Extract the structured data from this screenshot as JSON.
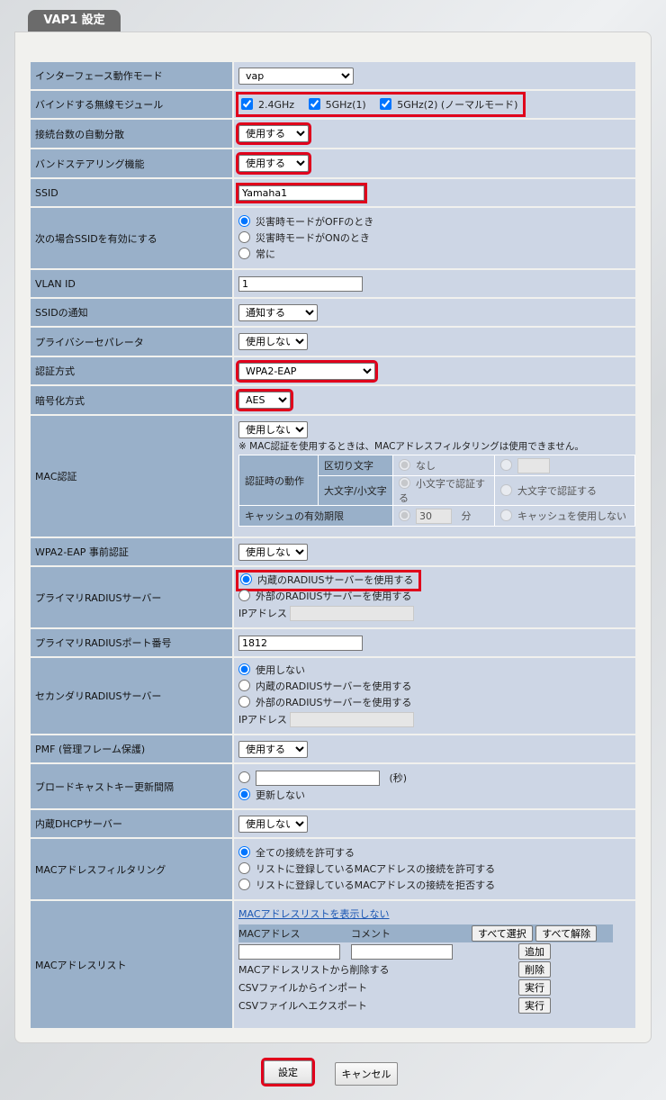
{
  "title": "VAP1 設定",
  "rows": {
    "interface_mode": {
      "label": "インターフェース動作モード",
      "value": "vap"
    },
    "bind_module": {
      "label": "バインドする無線モジュール",
      "opt1": "2.4GHz",
      "opt2": "5GHz(1)",
      "opt3": "5GHz(2) (ノーマルモード)"
    },
    "auto_distribute": {
      "label": "接続台数の自動分散",
      "value": "使用する"
    },
    "band_steering": {
      "label": "バンドステアリング機能",
      "value": "使用する"
    },
    "ssid": {
      "label": "SSID",
      "value": "Yamaha1"
    },
    "ssid_enable": {
      "label": "次の場合SSIDを有効にする",
      "opt1": "災害時モードがOFFのとき",
      "opt2": "災害時モードがONのとき",
      "opt3": "常に"
    },
    "vlan": {
      "label": "VLAN ID",
      "value": "1"
    },
    "ssid_notify": {
      "label": "SSIDの通知",
      "value": "通知する"
    },
    "privacy": {
      "label": "プライバシーセパレータ",
      "value": "使用しない"
    },
    "auth": {
      "label": "認証方式",
      "value": "WPA2-EAP"
    },
    "enc": {
      "label": "暗号化方式",
      "value": "AES"
    },
    "mac_auth": {
      "label": "MAC認証",
      "value": "使用しない",
      "note": "※ MAC認証を使用するときは、MACアドレスフィルタリングは使用できません。",
      "action": "認証時の動作",
      "sep": "区切り文字",
      "none": "なし",
      "case": "大文字/小文字",
      "lower": "小文字で認証する",
      "upper": "大文字で認証する",
      "cache": "キャッシュの有効期限",
      "cache_val": "30",
      "min": "分",
      "nocache": "キャッシュを使用しない"
    },
    "preauth": {
      "label": "WPA2-EAP 事前認証",
      "value": "使用しない"
    },
    "primary_radius": {
      "label": "プライマリRADIUSサーバー",
      "opt1": "内蔵のRADIUSサーバーを使用する",
      "opt2": "外部のRADIUSサーバーを使用する",
      "ip": "IPアドレス"
    },
    "primary_port": {
      "label": "プライマリRADIUSポート番号",
      "value": "1812"
    },
    "secondary_radius": {
      "label": "セカンダリRADIUSサーバー",
      "opt1": "使用しない",
      "opt2": "内蔵のRADIUSサーバーを使用する",
      "opt3": "外部のRADIUSサーバーを使用する",
      "ip": "IPアドレス"
    },
    "pmf": {
      "label": "PMF (管理フレーム保護)",
      "value": "使用する"
    },
    "broadcast": {
      "label": "ブロードキャストキー更新間隔",
      "unit": "(秒)",
      "opt2": "更新しない"
    },
    "dhcp": {
      "label": "内蔵DHCPサーバー",
      "value": "使用しない"
    },
    "mac_filter": {
      "label": "MACアドレスフィルタリング",
      "opt1": "全ての接続を許可する",
      "opt2": "リストに登録しているMACアドレスの接続を許可する",
      "opt3": "リストに登録しているMACアドレスの接続を拒否する"
    },
    "mac_list": {
      "label": "MACアドレスリスト",
      "link": "MACアドレスリストを表示しない",
      "col1": "MACアドレス",
      "col2": "コメント",
      "select_all": "すべて選択",
      "deselect_all": "すべて解除",
      "add": "追加",
      "delete_label": "MACアドレスリストから削除する",
      "delete": "削除",
      "import_label": "CSVファイルからインポート",
      "run1": "実行",
      "export_label": "CSVファイルへエクスポート",
      "run2": "実行"
    }
  },
  "buttons": {
    "set": "設定",
    "cancel": "キャンセル"
  }
}
